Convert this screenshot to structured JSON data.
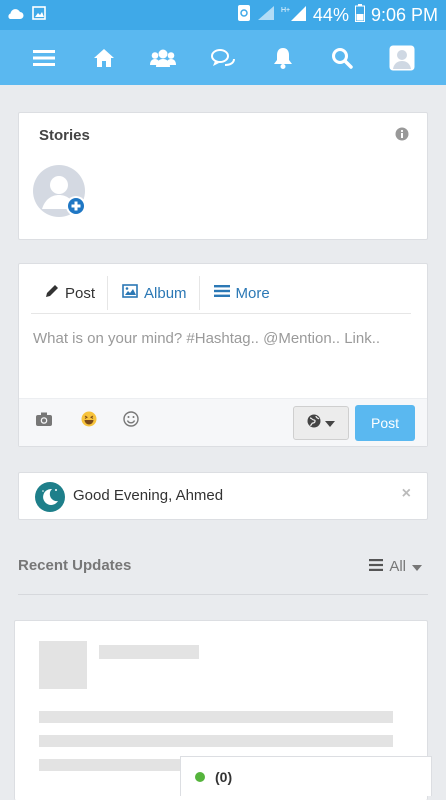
{
  "statusbar": {
    "battery": "44%",
    "time": "9:06 PM"
  },
  "nav": {
    "icons": [
      "menu-icon",
      "home-icon",
      "users-icon",
      "messages-icon",
      "bell-icon",
      "search-icon",
      "profile-icon"
    ]
  },
  "stories": {
    "title": "Stories"
  },
  "composer": {
    "tabs": [
      {
        "label": "Post",
        "icon": "pencil-icon"
      },
      {
        "label": "Album",
        "icon": "image-icon"
      },
      {
        "label": "More",
        "icon": "list-icon"
      }
    ],
    "placeholder": "What is on your mind? #Hashtag.. @Mention.. Link..",
    "post_label": "Post"
  },
  "greeting": {
    "text": "Good Evening, Ahmed",
    "close": "×"
  },
  "recent": {
    "label": "Recent Updates",
    "filter": "All"
  },
  "chat": {
    "count": "(0)"
  },
  "colors": {
    "primary": "#5ab8f0",
    "statusbar": "#3fa9e8",
    "online": "#55b43c"
  }
}
